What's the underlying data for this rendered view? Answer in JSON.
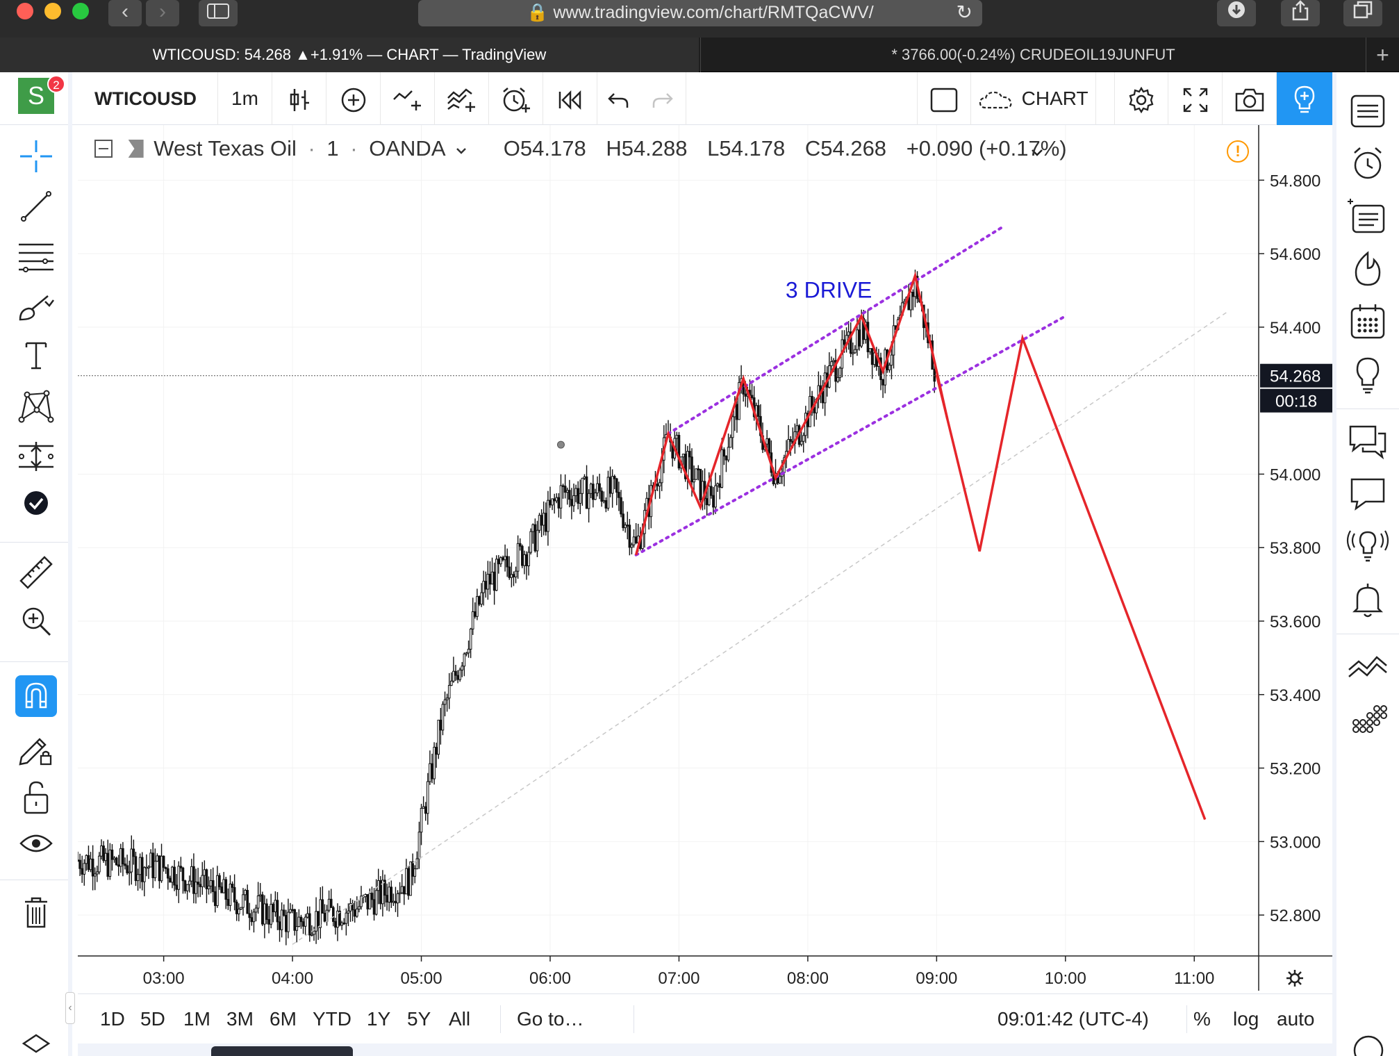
{
  "browser": {
    "url": "www.tradingview.com/chart/RMTQaCWV/",
    "tabs": [
      {
        "label": "WTICOUSD: 54.268 ▲+1.91% — CHART — TradingView",
        "active": true
      },
      {
        "label": "* 3766.00(-0.24%) CRUDEOIL19JUNFUT",
        "active": false
      }
    ],
    "new_tab": "+"
  },
  "account": {
    "avatar_letter": "S",
    "notifications": "2"
  },
  "toolbar": {
    "symbol": "WTICOUSD",
    "interval": "1m",
    "layout_name": "CHART"
  },
  "legend": {
    "instrument": "West Texas Oil",
    "interval": "1",
    "source": "OANDA",
    "open": "O54.178",
    "high": "H54.288",
    "low": "L54.178",
    "close": "C54.268",
    "change": "+0.090 (+0.17%)"
  },
  "annotation": {
    "text": "3 DRIVE",
    "color": "#1a1ad6"
  },
  "price_scale": {
    "ticks": [
      "54.800",
      "54.600",
      "54.400",
      "54.000",
      "53.800",
      "53.600",
      "53.400",
      "53.200",
      "53.000",
      "52.800"
    ],
    "last_price": "54.268",
    "countdown": "00:18"
  },
  "time_scale": {
    "ticks": [
      "03:00",
      "04:00",
      "05:00",
      "06:00",
      "07:00",
      "08:00",
      "09:00",
      "10:00",
      "11:00"
    ]
  },
  "bottom": {
    "ranges": [
      "1D",
      "5D",
      "1M",
      "3M",
      "6M",
      "YTD",
      "1Y",
      "5Y",
      "All"
    ],
    "goto": "Go to…",
    "clock": "09:01:42 (UTC-4)",
    "percent": "%",
    "log": "log",
    "auto": "auto"
  },
  "colors": {
    "accent": "#2962ff",
    "drawing_red": "#e5252a",
    "channel_purple": "#9b30e0",
    "candle": "#111111"
  },
  "chart_data": {
    "type": "candlestick",
    "symbol": "WTICOUSD",
    "ylim": [
      52.7,
      54.95
    ],
    "xlim_hours": [
      "02:20",
      "11:30"
    ],
    "approx_close_path": [
      {
        "x": "02:20",
        "y": 52.95
      },
      {
        "x": "03:00",
        "y": 52.93
      },
      {
        "x": "03:30",
        "y": 52.85
      },
      {
        "x": "04:00",
        "y": 52.78
      },
      {
        "x": "04:30",
        "y": 52.82
      },
      {
        "x": "04:55",
        "y": 52.9
      },
      {
        "x": "05:10",
        "y": 53.35
      },
      {
        "x": "05:30",
        "y": 53.7
      },
      {
        "x": "05:50",
        "y": 53.8
      },
      {
        "x": "06:05",
        "y": 53.95
      },
      {
        "x": "06:30",
        "y": 53.95
      },
      {
        "x": "06:40",
        "y": 53.8
      },
      {
        "x": "06:55",
        "y": 54.1
      },
      {
        "x": "07:15",
        "y": 53.92
      },
      {
        "x": "07:30",
        "y": 54.25
      },
      {
        "x": "07:45",
        "y": 54.0
      },
      {
        "x": "08:10",
        "y": 54.27
      },
      {
        "x": "08:25",
        "y": 54.4
      },
      {
        "x": "08:35",
        "y": 54.28
      },
      {
        "x": "08:50",
        "y": 54.52
      },
      {
        "x": "09:00",
        "y": 54.27
      }
    ],
    "drawings": {
      "three_drive_zigzag": [
        {
          "x": "06:40",
          "y": 53.78
        },
        {
          "x": "06:55",
          "y": 54.11
        },
        {
          "x": "07:10",
          "y": 53.91
        },
        {
          "x": "07:30",
          "y": 54.26
        },
        {
          "x": "07:45",
          "y": 53.99
        },
        {
          "x": "08:25",
          "y": 54.43
        },
        {
          "x": "08:35",
          "y": 54.28
        },
        {
          "x": "08:50",
          "y": 54.54
        },
        {
          "x": "09:05",
          "y": 54.15
        }
      ],
      "projection": [
        {
          "x": "09:00",
          "y": 54.27
        },
        {
          "x": "09:20",
          "y": 53.79
        },
        {
          "x": "09:40",
          "y": 54.37
        },
        {
          "x": "11:05",
          "y": 53.06
        }
      ],
      "channel_upper": [
        {
          "x": "06:55",
          "y": 54.11
        },
        {
          "x": "09:30",
          "y": 54.67
        }
      ],
      "channel_lower": [
        {
          "x": "06:40",
          "y": 53.78
        },
        {
          "x": "10:00",
          "y": 54.43
        }
      ],
      "trend_line": [
        {
          "x": "04:00",
          "y": 52.72
        },
        {
          "x": "11:15",
          "y": 54.44
        }
      ]
    }
  }
}
